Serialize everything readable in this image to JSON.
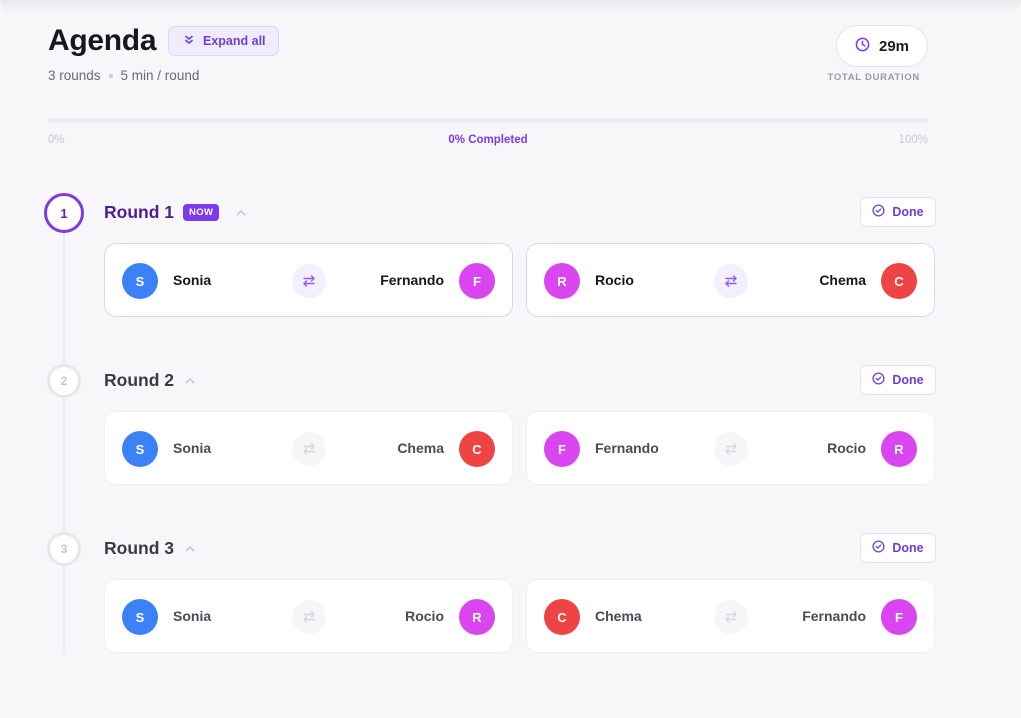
{
  "header": {
    "title": "Agenda",
    "expand_label": "Expand all",
    "rounds_count": "3 rounds",
    "per_round": "5 min / round",
    "duration": "29m",
    "duration_label": "TOTAL DURATION"
  },
  "progress": {
    "start_label": "0%",
    "completed_label": "0% Completed",
    "end_label": "100%",
    "value": 0
  },
  "colors": {
    "accent": "#7c3aed",
    "avatar_blue": "#3b82f6",
    "avatar_magenta": "#d946ef",
    "avatar_red": "#ef4444"
  },
  "rounds": [
    {
      "title": "Round 1",
      "number": "1",
      "badge": "NOW",
      "done_label": "Done",
      "pairs": [
        {
          "left": {
            "initial": "S",
            "name": "Sonia",
            "color": "#3b82f6"
          },
          "right": {
            "initial": "F",
            "name": "Fernando",
            "color": "#d946ef"
          }
        },
        {
          "left": {
            "initial": "R",
            "name": "Rocio",
            "color": "#d946ef"
          },
          "right": {
            "initial": "C",
            "name": "Chema",
            "color": "#ef4444"
          }
        }
      ]
    },
    {
      "title": "Round 2",
      "number": "2",
      "done_label": "Done",
      "pairs": [
        {
          "left": {
            "initial": "S",
            "name": "Sonia",
            "color": "#3b82f6"
          },
          "right": {
            "initial": "C",
            "name": "Chema",
            "color": "#ef4444"
          }
        },
        {
          "left": {
            "initial": "F",
            "name": "Fernando",
            "color": "#d946ef"
          },
          "right": {
            "initial": "R",
            "name": "Rocio",
            "color": "#d946ef"
          }
        }
      ]
    },
    {
      "title": "Round 3",
      "number": "3",
      "done_label": "Done",
      "pairs": [
        {
          "left": {
            "initial": "S",
            "name": "Sonia",
            "color": "#3b82f6"
          },
          "right": {
            "initial": "R",
            "name": "Rocio",
            "color": "#d946ef"
          }
        },
        {
          "left": {
            "initial": "C",
            "name": "Chema",
            "color": "#ef4444"
          },
          "right": {
            "initial": "F",
            "name": "Fernando",
            "color": "#d946ef"
          }
        }
      ]
    }
  ]
}
